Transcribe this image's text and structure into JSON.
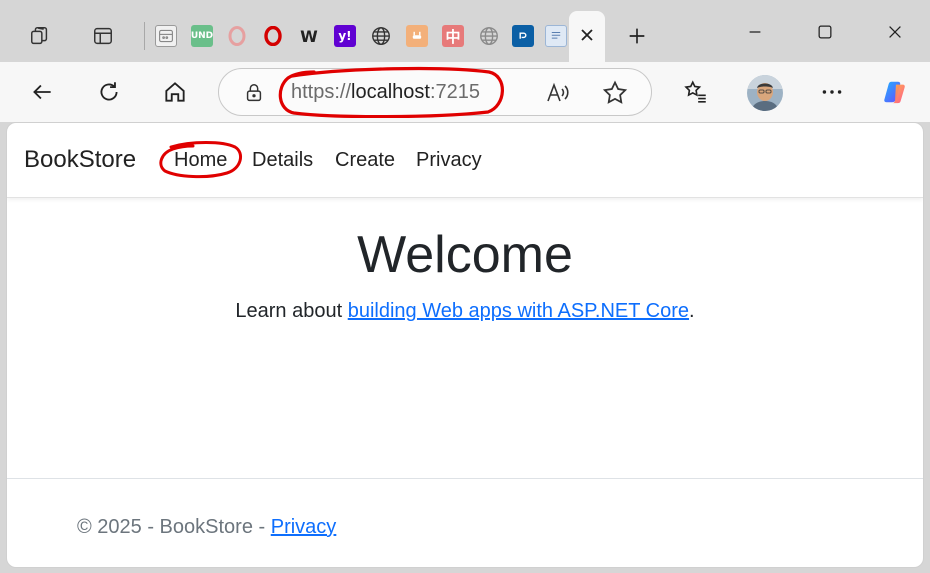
{
  "browser": {
    "tabs": [
      {
        "icon": "collections-icon"
      },
      {
        "icon": "tab-actions-icon"
      },
      {
        "icon": "calendar-favicon"
      },
      {
        "icon": "und-favicon",
        "text": "UND"
      },
      {
        "icon": "opera-favicon"
      },
      {
        "icon": "opera-red-favicon"
      },
      {
        "icon": "w-favicon",
        "text": "W"
      },
      {
        "icon": "yahoo-favicon",
        "text": "y!"
      },
      {
        "icon": "globe-favicon"
      },
      {
        "icon": "plug-favicon"
      },
      {
        "icon": "zhong-favicon",
        "text": "中"
      },
      {
        "icon": "globe-gray-favicon"
      },
      {
        "icon": "blue-app-favicon"
      },
      {
        "icon": "document-favicon"
      }
    ],
    "active_tab_close": "close-icon",
    "new_tab": "plus-icon",
    "window_controls": [
      "minimize-icon",
      "maximize-icon",
      "close-icon"
    ]
  },
  "toolbar": {
    "url_scheme": "https://",
    "url_host": "localhost",
    "url_port": ":7215",
    "icons": [
      "back-arrow-icon",
      "refresh-icon",
      "home-icon",
      "lock-icon",
      "read-aloud-icon",
      "favorite-star-icon",
      "favorites-list-icon",
      "profile-avatar",
      "more-icon",
      "copilot-icon"
    ]
  },
  "page": {
    "brand": "BookStore",
    "nav": [
      "Home",
      "Details",
      "Create",
      "Privacy"
    ],
    "heading": "Welcome",
    "learn_prefix": "Learn about ",
    "learn_link": "building Web apps with ASP.NET Core",
    "learn_suffix": ".",
    "footer_text": "© 2025 - BookStore - ",
    "footer_link": "Privacy"
  },
  "colors": {
    "annotation": "#e00000",
    "link": "#0d6efd",
    "tabstrip": "#d6d6d6",
    "toolbar": "#f7f7f7"
  }
}
